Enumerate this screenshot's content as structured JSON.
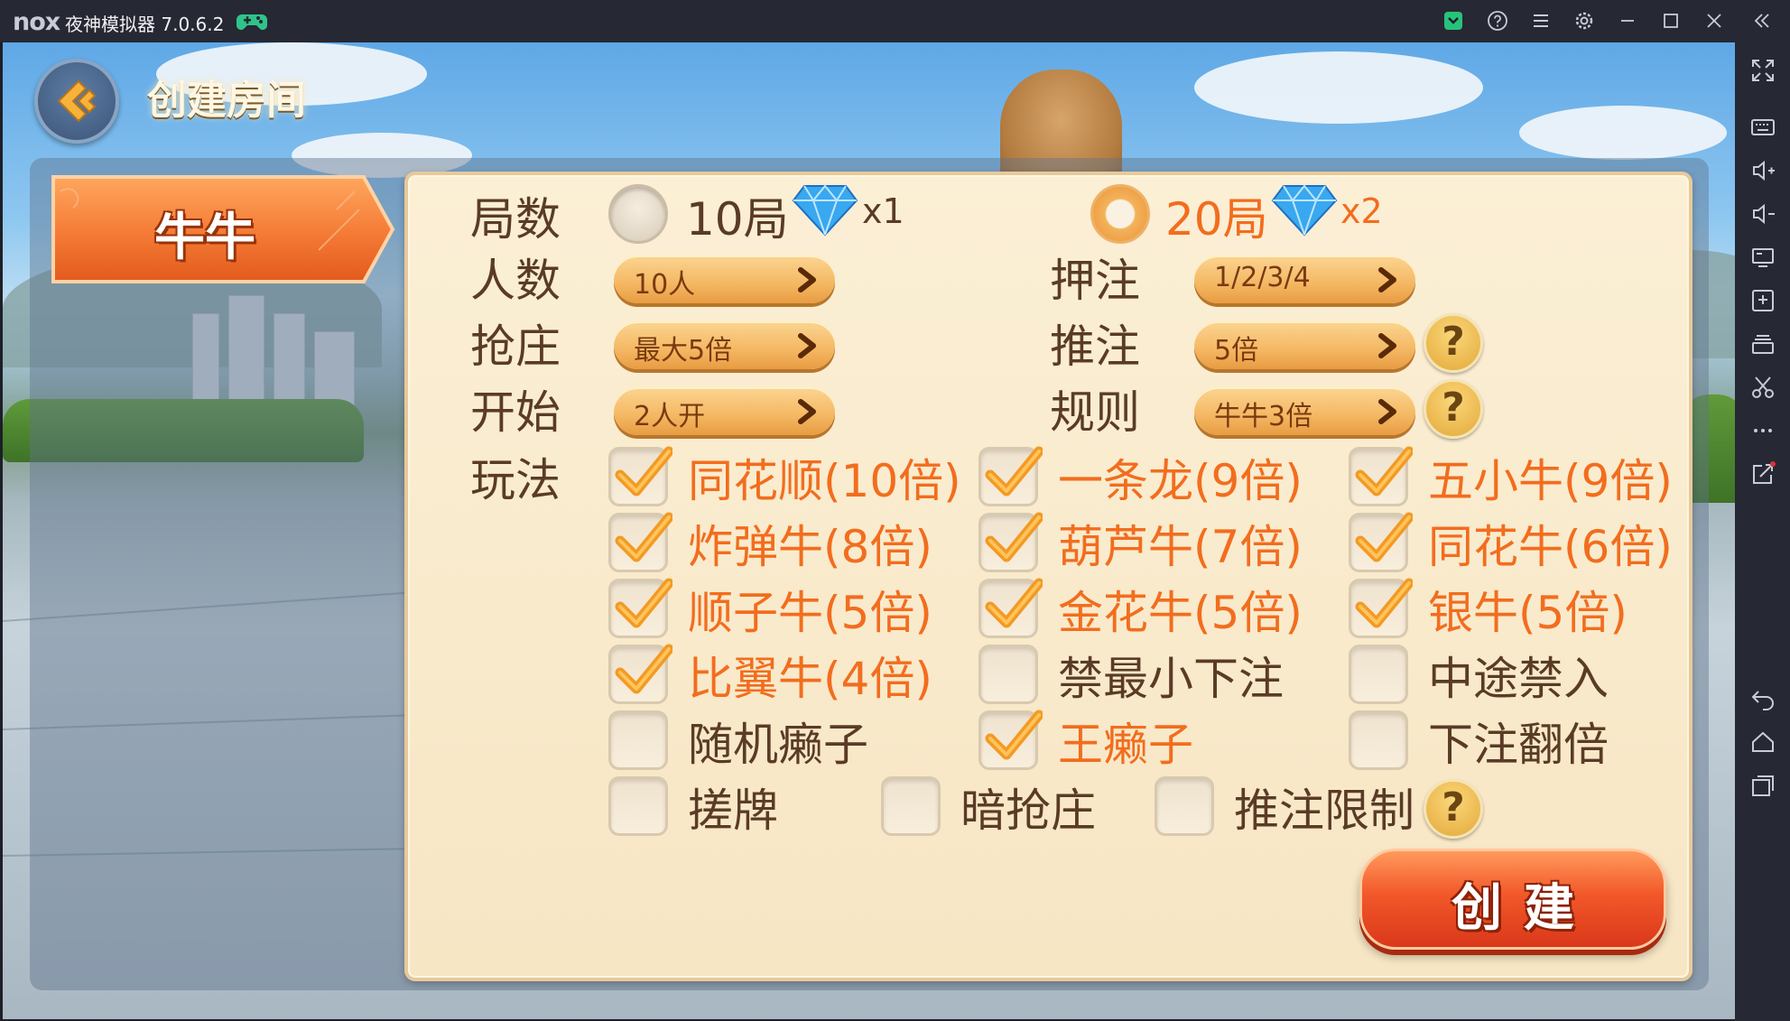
{
  "window": {
    "logo": "nox",
    "title": "夜神模拟器 7.0.6.2",
    "controls": [
      "notification-icon",
      "help-icon",
      "menu-icon",
      "settings-icon",
      "minimize-icon",
      "maximize-icon",
      "close-icon",
      "collapse-sidebar-icon"
    ]
  },
  "sidebar": {
    "items": [
      "fullscreen-icon",
      "keyboard-icon",
      "volume-up-icon",
      "volume-down-icon",
      "screen-icon",
      "apk-install-icon",
      "multi-instance-icon",
      "screenshot-icon",
      "more-icon",
      "share-icon",
      "back-nav-icon",
      "home-nav-icon",
      "recents-nav-icon"
    ]
  },
  "header": {
    "title": "创建房间"
  },
  "game_tab": {
    "label": "牛牛"
  },
  "settings": {
    "rounds": {
      "label": "局数",
      "options": [
        {
          "text": "10局",
          "multiplier": "x1",
          "selected": false
        },
        {
          "text": "20局",
          "multiplier": "x2",
          "selected": true
        }
      ]
    },
    "players": {
      "label": "人数",
      "value": "10人"
    },
    "bet": {
      "label": "押注",
      "value": "1/2/3/4"
    },
    "banker": {
      "label": "抢庄",
      "value": "最大5倍"
    },
    "push_bet": {
      "label": "推注",
      "value": "5倍"
    },
    "start": {
      "label": "开始",
      "value": "2人开"
    },
    "rule": {
      "label": "规则",
      "value": "牛牛3倍"
    },
    "play": {
      "label": "玩法",
      "options": [
        {
          "text": "同花顺(10倍)",
          "checked": true
        },
        {
          "text": "一条龙(9倍)",
          "checked": true
        },
        {
          "text": "五小牛(9倍)",
          "checked": true
        },
        {
          "text": "炸弹牛(8倍)",
          "checked": true
        },
        {
          "text": "葫芦牛(7倍)",
          "checked": true
        },
        {
          "text": "同花牛(6倍)",
          "checked": true
        },
        {
          "text": "顺子牛(5倍)",
          "checked": true
        },
        {
          "text": "金花牛(5倍)",
          "checked": true
        },
        {
          "text": "银牛(5倍)",
          "checked": true
        },
        {
          "text": "比翼牛(4倍)",
          "checked": true
        },
        {
          "text": "禁最小下注",
          "checked": false
        },
        {
          "text": "中途禁入",
          "checked": false
        },
        {
          "text": "随机癞子",
          "checked": false
        },
        {
          "text": "王癞子",
          "checked": true
        },
        {
          "text": "下注翻倍",
          "checked": false
        },
        {
          "text": "搓牌",
          "checked": false
        },
        {
          "text": "暗抢庄",
          "checked": false
        },
        {
          "text": "推注限制",
          "checked": false
        }
      ]
    },
    "help_symbol": "?"
  },
  "create_button": {
    "label": "创建"
  },
  "colors": {
    "accent_orange": "#f26d1e",
    "label_brown": "#5a3b26",
    "panel_bg": "#fbefd5"
  }
}
